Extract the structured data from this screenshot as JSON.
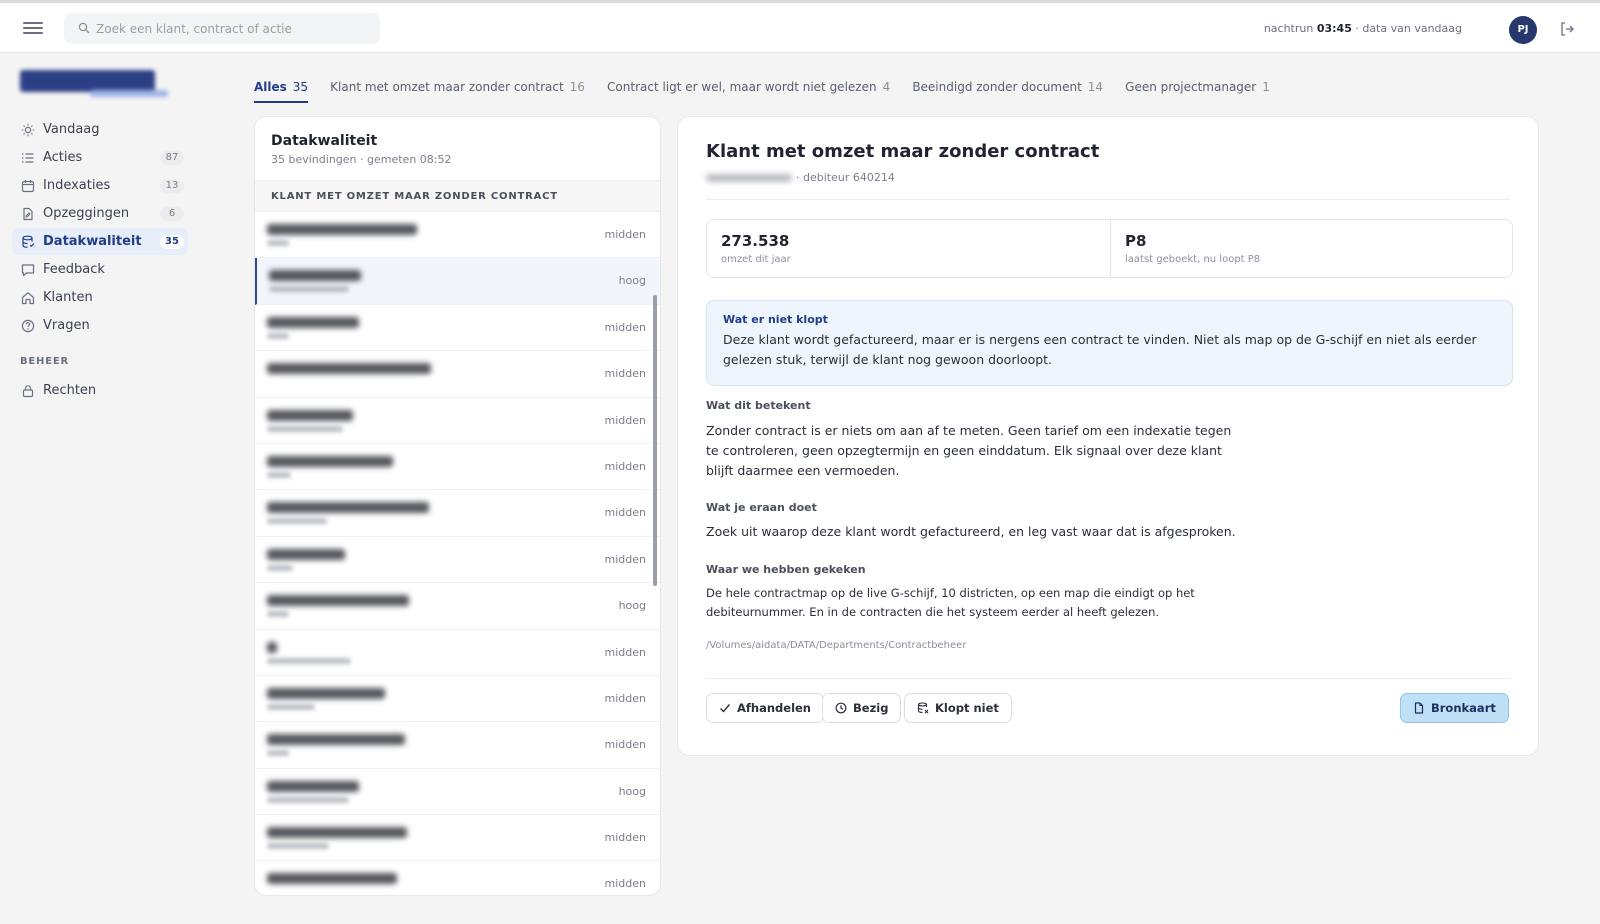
{
  "header": {
    "search_placeholder": "Zoek een klant, contract of actie",
    "status_prefix": "nachtrun",
    "status_time": "03:45",
    "status_suffix": "· data van vandaag",
    "avatar_initials": "PJ"
  },
  "sidebar": {
    "items": [
      {
        "label": "Vandaag",
        "icon": "sun-icon",
        "count": null,
        "active": false
      },
      {
        "label": "Acties",
        "icon": "list-icon",
        "count": "87",
        "active": false
      },
      {
        "label": "Indexaties",
        "icon": "calendar-icon",
        "count": "13",
        "active": false
      },
      {
        "label": "Opzeggingen",
        "icon": "document-edit-icon",
        "count": "6",
        "active": false
      },
      {
        "label": "Datakwaliteit",
        "icon": "database-icon",
        "count": "35",
        "active": true
      },
      {
        "label": "Feedback",
        "icon": "chat-icon",
        "count": null,
        "active": false
      },
      {
        "label": "Klanten",
        "icon": "home-icon",
        "count": null,
        "active": false
      },
      {
        "label": "Vragen",
        "icon": "question-icon",
        "count": null,
        "active": false
      }
    ],
    "section_label": "BEHEER",
    "admin_items": [
      {
        "label": "Rechten",
        "icon": "lock-icon"
      }
    ]
  },
  "tabs": [
    {
      "label": "Alles",
      "count": "35",
      "active": true
    },
    {
      "label": "Klant met omzet maar zonder contract",
      "count": "16",
      "active": false
    },
    {
      "label": "Contract ligt er wel, maar wordt niet gelezen",
      "count": "4",
      "active": false
    },
    {
      "label": "Beeindigd zonder document",
      "count": "14",
      "active": false
    },
    {
      "label": "Geen projectmanager",
      "count": "1",
      "active": false
    }
  ],
  "list": {
    "title": "Datakwaliteit",
    "subtitle": "35 bevindingen · gemeten 08:52",
    "group_label": "KLANT MET OMZET MAAR ZONDER CONTRACT",
    "rows": [
      {
        "severity": "midden"
      },
      {
        "severity": "hoog"
      },
      {
        "severity": "midden"
      },
      {
        "severity": "midden"
      },
      {
        "severity": "midden"
      },
      {
        "severity": "midden"
      },
      {
        "severity": "midden"
      },
      {
        "severity": "midden"
      },
      {
        "severity": "hoog"
      },
      {
        "severity": "midden"
      },
      {
        "severity": "midden"
      },
      {
        "severity": "midden"
      },
      {
        "severity": "hoog"
      },
      {
        "severity": "midden"
      },
      {
        "severity": "midden"
      }
    ]
  },
  "detail": {
    "title": "Klant met omzet maar zonder contract",
    "debtor": "· debiteur 640214",
    "metric1_value": "273.538",
    "metric1_label": "omzet dit jaar",
    "metric2_value": "P8",
    "metric2_label": "laatst geboekt, nu loopt P8",
    "alert_title": "Wat er niet klopt",
    "alert_text": "Deze klant wordt gefactureerd, maar er is nergens een contract te vinden. Niet als map op de G-schijf en niet als eerder gelezen stuk, terwijl de klant nog gewoon doorloopt.",
    "meaning_title": "Wat dit betekent",
    "meaning_text": "Zonder contract is er niets om aan af te meten. Geen tarief om een indexatie tegen te controleren, geen opzegtermijn en geen einddatum. Elk signaal over deze klant blijft daarmee een vermoeden.",
    "action_title": "Wat je eraan doet",
    "action_text": "Zoek uit waarop deze klant wordt gefactureerd, en leg vast waar dat is afgesproken.",
    "looked_title": "Waar we hebben gekeken",
    "looked_text": "De hele contractmap op de live G-schijf, 10 districten, op een map die eindigt op het debiteurnummer. En in de contracten die het systeem eerder al heeft gelezen.",
    "path": "/Volumes/aidata/DATA/Departments/Contractbeheer",
    "buttons": {
      "resolve": "Afhandelen",
      "busy": "Bezig",
      "wrong": "Klopt niet",
      "source": "Bronkaart"
    }
  },
  "colors": {
    "accent": "#1f3d8a",
    "avatar": "#26386d",
    "primary_button": "#bfe0f7",
    "alert_bg": "#eff5fc"
  }
}
